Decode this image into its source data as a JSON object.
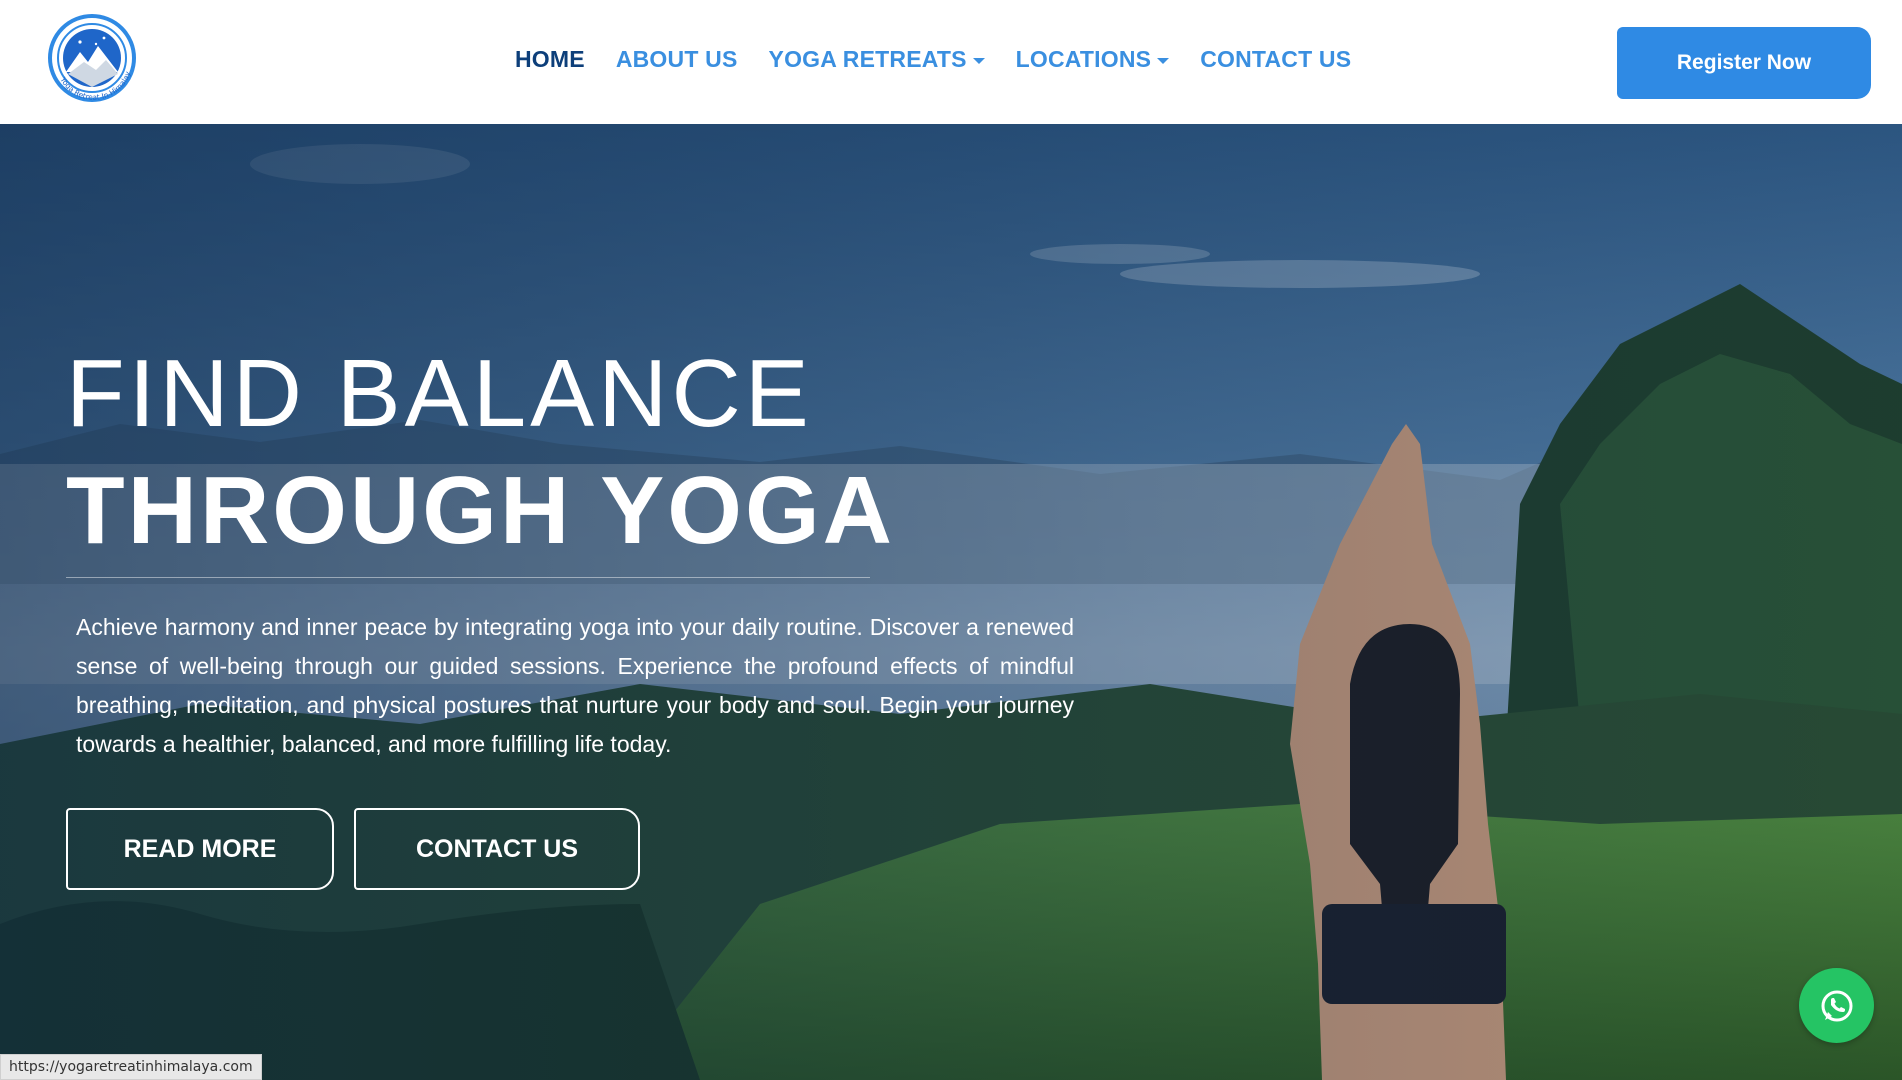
{
  "brand": {
    "logo_icon": "mountain-stars-logo",
    "logo_text": "Yoga Retreat In Himalaya"
  },
  "nav": {
    "items": [
      {
        "label": "HOME",
        "active": true,
        "dropdown": false
      },
      {
        "label": "ABOUT US",
        "active": false,
        "dropdown": false
      },
      {
        "label": "YOGA RETREATS",
        "active": false,
        "dropdown": true
      },
      {
        "label": "LOCATIONS",
        "active": false,
        "dropdown": true
      },
      {
        "label": "CONTACT US",
        "active": false,
        "dropdown": false
      }
    ],
    "cta_label": "Register Now"
  },
  "hero": {
    "title_line1": "FIND BALANCE",
    "title_line2": "THROUGH YOGA",
    "description": "Achieve harmony and inner peace by integrating yoga into your daily routine. Discover a renewed sense of well-being through our guided sessions. Experience the profound effects of mindful breathing, meditation, and physical postures that nurture your body and soul. Begin your journey towards a healthier, balanced, and more fulfilling life today.",
    "buttons": {
      "read_more": "READ MORE",
      "contact_us": "CONTACT US"
    },
    "background_icon": "mountain-yoga-landscape"
  },
  "floating": {
    "whatsapp_icon": "whatsapp-icon"
  },
  "status_bar": {
    "url": "https://yogaretreatinhimalaya.com"
  },
  "colors": {
    "nav_active": "#0d3f7a",
    "nav_link": "#3a8fe0",
    "cta": "#2f8ae4",
    "whatsapp": "#25c464"
  }
}
